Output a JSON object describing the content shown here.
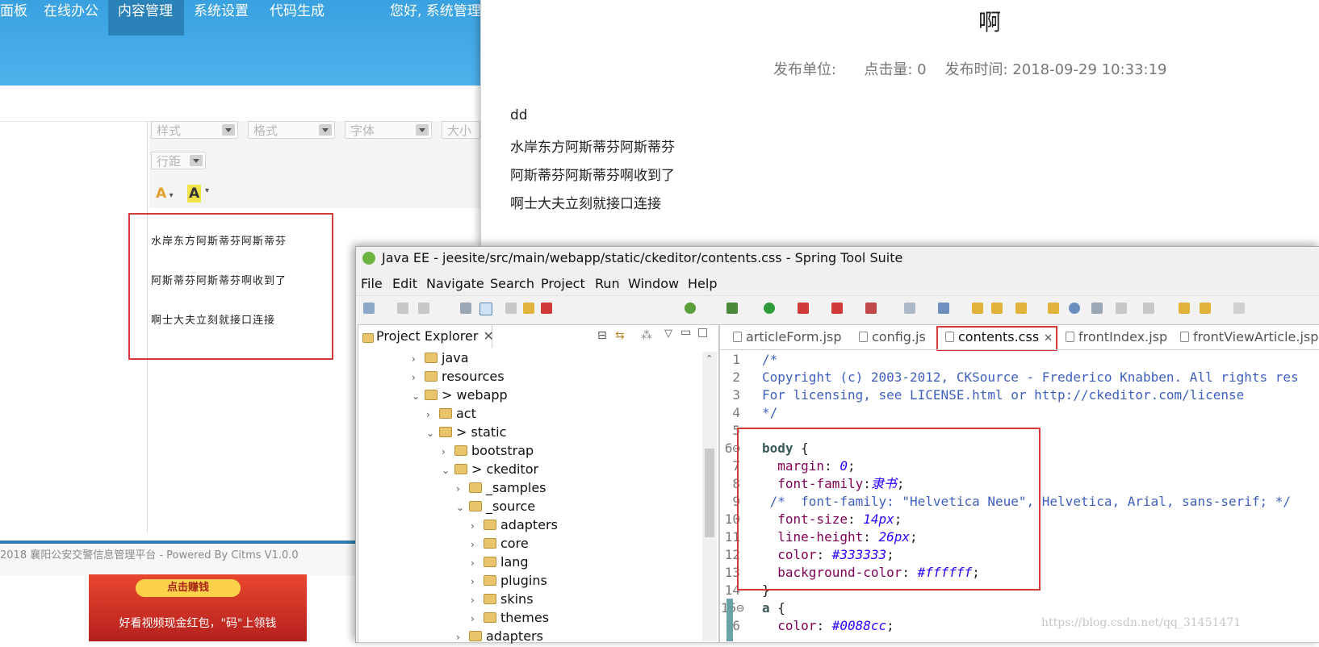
{
  "admin": {
    "nav": [
      "面板",
      "在线办公",
      "内容管理",
      "系统设置",
      "代码生成"
    ],
    "active_nav": "内容管理",
    "greeting": "您好, 系统管理",
    "editor_toolbar": {
      "combos": [
        "样式",
        "格式",
        "字体",
        "大小"
      ],
      "line_height": "行距",
      "font_color": "A",
      "bg_color": "A"
    },
    "editor_lines": [
      "水岸东方阿斯蒂芬阿斯蒂芬",
      "阿斯蒂芬阿斯蒂芬啊收到了",
      "啊士大夫立刻就接口连接"
    ],
    "footer": "2018 襄阳公安交警信息管理平台 - Powered By Citms V1.0.0",
    "ad": {
      "button": "点击赚钱",
      "text": "好看视频现金红包，\"码\"上领钱"
    }
  },
  "preview": {
    "title": "啊",
    "meta": "发布单位:      点击量: 0    发布时间: 2018-09-29 10:33:19",
    "lines": [
      "dd",
      "水岸东方阿斯蒂芬阿斯蒂芬",
      "阿斯蒂芬阿斯蒂芬啊收到了",
      "啊士大夫立刻就接口连接"
    ]
  },
  "sts": {
    "title": "Java EE - jeesite/src/main/webapp/static/ckeditor/contents.css - Spring Tool Suite",
    "menu": [
      "File",
      "Edit",
      "Navigate",
      "Search",
      "Project",
      "Run",
      "Window",
      "Help"
    ],
    "explorer": {
      "tab": "Project Explorer",
      "tree": [
        {
          "twisty": "›",
          "label": "java"
        },
        {
          "twisty": "›",
          "label": "resources"
        },
        {
          "twisty": "⌄",
          "label": "> webapp"
        },
        {
          "twisty": "›",
          "label": "act"
        },
        {
          "twisty": "⌄",
          "label": "> static"
        },
        {
          "twisty": "›",
          "label": "bootstrap"
        },
        {
          "twisty": "⌄",
          "label": "> ckeditor"
        },
        {
          "twisty": "›",
          "label": "_samples"
        },
        {
          "twisty": "⌄",
          "label": "_source"
        },
        {
          "twisty": "›",
          "label": "adapters"
        },
        {
          "twisty": "›",
          "label": "core"
        },
        {
          "twisty": "›",
          "label": "lang"
        },
        {
          "twisty": "›",
          "label": "plugins"
        },
        {
          "twisty": "›",
          "label": "skins"
        },
        {
          "twisty": "›",
          "label": "themes"
        },
        {
          "twisty": "›",
          "label": "adapters"
        }
      ]
    },
    "editor_tabs": [
      "articleForm.jsp",
      "config.js",
      "contents.css",
      "frontIndex.jsp",
      "frontViewArticle.jsp"
    ],
    "active_tab": "contents.css",
    "code": [
      {
        "n": "1",
        "parts": [
          [
            "cm",
            "/*"
          ]
        ]
      },
      {
        "n": "2",
        "parts": [
          [
            "cm",
            "Copyright (c) 2003-2012, CKSource - Frederico Knabben. All rights res"
          ]
        ]
      },
      {
        "n": "3",
        "parts": [
          [
            "cm",
            "For licensing, see LICENSE.html or http://ckeditor.com/license"
          ]
        ]
      },
      {
        "n": "4",
        "parts": [
          [
            "cm",
            "*/"
          ]
        ]
      },
      {
        "n": "5",
        "parts": []
      },
      {
        "n": "6⊖",
        "parts": [
          [
            "kw",
            "body"
          ],
          [
            "pl",
            " {"
          ]
        ]
      },
      {
        "n": "7",
        "parts": [
          [
            "pl",
            "  "
          ],
          [
            "pr",
            "margin"
          ],
          [
            "pl",
            ": "
          ],
          [
            "vl",
            "0"
          ],
          [
            "pl",
            ";"
          ]
        ]
      },
      {
        "n": "8",
        "parts": [
          [
            "pl",
            "  "
          ],
          [
            "pr",
            "font-family"
          ],
          [
            "pl",
            ":"
          ],
          [
            "vl",
            "隶书"
          ],
          [
            "pl",
            ";"
          ]
        ]
      },
      {
        "n": "9",
        "parts": [
          [
            "cm",
            " /*  font-family: \"Helvetica Neue\", Helvetica, Arial, sans-serif; */"
          ]
        ]
      },
      {
        "n": "10",
        "parts": [
          [
            "pl",
            "  "
          ],
          [
            "pr",
            "font-size"
          ],
          [
            "pl",
            ": "
          ],
          [
            "vl",
            "14px"
          ],
          [
            "pl",
            ";"
          ]
        ]
      },
      {
        "n": "11",
        "parts": [
          [
            "pl",
            "  "
          ],
          [
            "pr",
            "line-height"
          ],
          [
            "pl",
            ": "
          ],
          [
            "vl",
            "26px"
          ],
          [
            "pl",
            ";"
          ]
        ]
      },
      {
        "n": "12",
        "parts": [
          [
            "pl",
            "  "
          ],
          [
            "pr",
            "color"
          ],
          [
            "pl",
            ": "
          ],
          [
            "vl",
            "#333333"
          ],
          [
            "pl",
            ";"
          ]
        ]
      },
      {
        "n": "13",
        "parts": [
          [
            "pl",
            "  "
          ],
          [
            "pr",
            "background-color"
          ],
          [
            "pl",
            ": "
          ],
          [
            "vl",
            "#ffffff"
          ],
          [
            "pl",
            ";"
          ]
        ]
      },
      {
        "n": "14",
        "parts": [
          [
            "pl",
            "}"
          ]
        ]
      },
      {
        "n": "15⊖",
        "parts": [
          [
            "kw",
            "a"
          ],
          [
            "pl",
            " {"
          ]
        ]
      },
      {
        "n": "16",
        "parts": [
          [
            "pl",
            "  "
          ],
          [
            "pr",
            "color"
          ],
          [
            "pl",
            ": "
          ],
          [
            "vl",
            "#0088cc"
          ],
          [
            "pl",
            ";"
          ]
        ]
      }
    ]
  },
  "watermark": "https://blog.csdn.net/qq_31451471",
  "colors": {
    "accent": "#4fb2ec",
    "highlight": "#d23a3a"
  }
}
